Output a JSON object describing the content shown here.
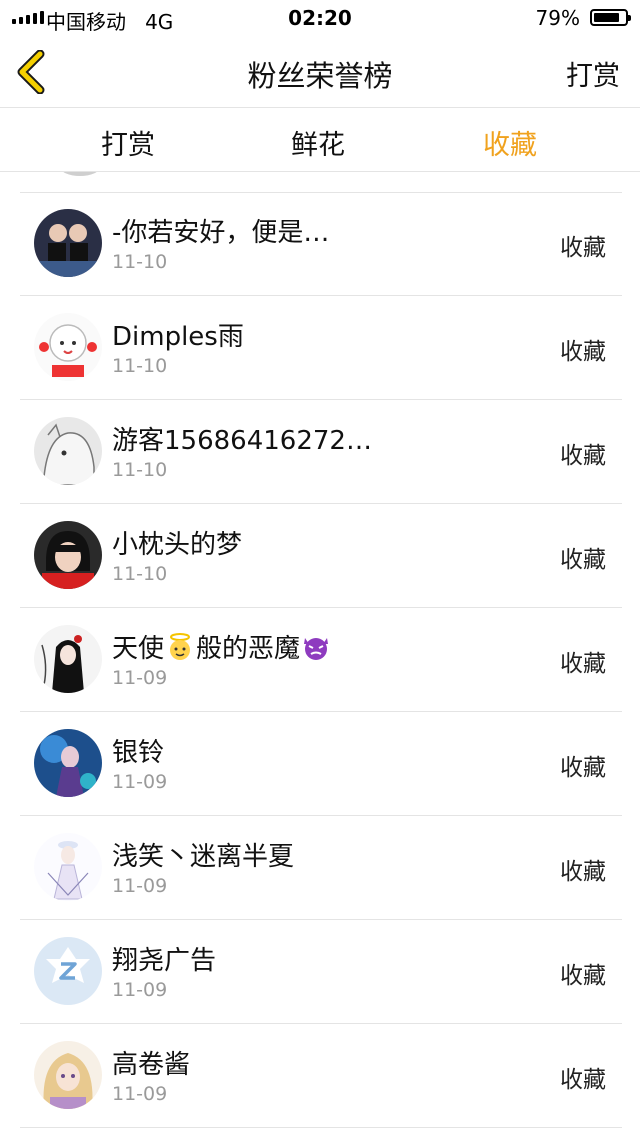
{
  "status_bar": {
    "carrier": "中国移动",
    "network": "4G",
    "time": "02:20",
    "battery": "79%",
    "battery_level": 0.79
  },
  "nav": {
    "back_icon": "chevron-left-icon",
    "title": "粉丝荣誉榜",
    "right_label": "打赏",
    "accent_color": "#f0a21e"
  },
  "tabs": [
    {
      "label": "打赏",
      "active": false
    },
    {
      "label": "鲜花",
      "active": false
    },
    {
      "label": "收藏",
      "active": true
    }
  ],
  "rows": [
    {
      "name": "-你若安好，便是…",
      "date": "11-10",
      "action": "收藏"
    },
    {
      "name": "Dimples雨",
      "date": "11-10",
      "action": "收藏"
    },
    {
      "name": "游客15686416272…",
      "date": "11-10",
      "action": "收藏"
    },
    {
      "name": "小枕头的梦",
      "date": "11-10",
      "action": "收藏"
    },
    {
      "name_prefix": "天使",
      "name_suffix": "般的恶魔",
      "date": "11-09",
      "action": "收藏",
      "icons": [
        "angel-emoji-icon",
        "devil-emoji-icon"
      ]
    },
    {
      "name": "银铃",
      "date": "11-09",
      "action": "收藏"
    },
    {
      "name": "浅笑丶迷离半夏",
      "date": "11-09",
      "action": "收藏"
    },
    {
      "name": "翔尧广告",
      "date": "11-09",
      "action": "收藏"
    },
    {
      "name": "高卷酱",
      "date": "11-09",
      "action": "收藏"
    }
  ]
}
